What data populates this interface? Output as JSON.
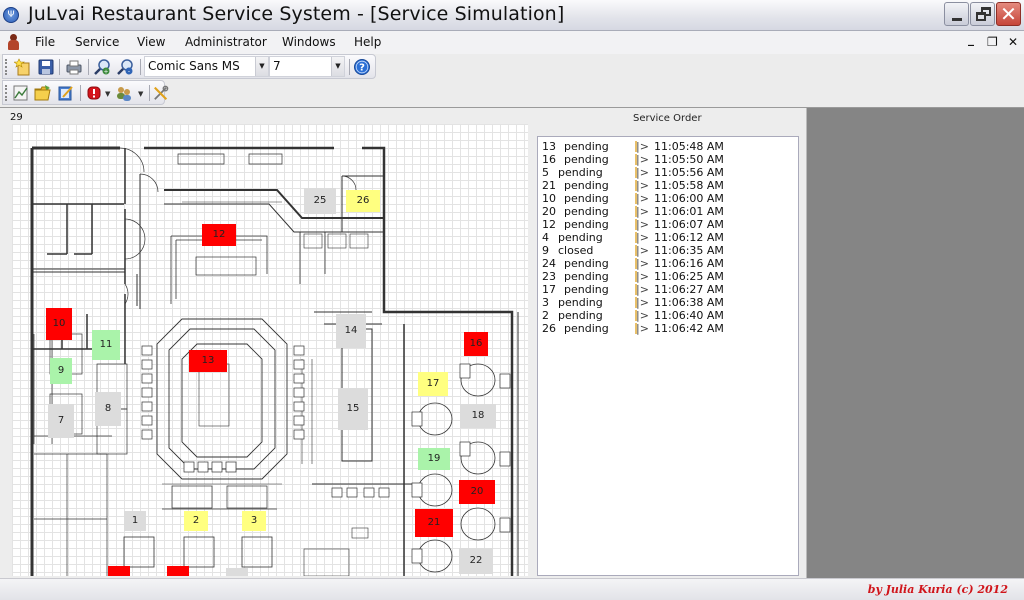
{
  "window": {
    "title": "JuLvai Restaurant Service System - [Service Simulation]",
    "controls": {
      "minimize": "_",
      "restore": "❐",
      "close": "✕"
    }
  },
  "menubar": {
    "items": [
      "File",
      "Service",
      "View",
      "Administrator",
      "Windows",
      "Help"
    ],
    "mdi_controls": {
      "minimize": "_",
      "restore": "❐",
      "close": "✕"
    }
  },
  "toolbar1": {
    "icons": [
      "new-icon",
      "save-icon",
      "print-icon",
      "zoom-in-icon",
      "zoom-out-icon",
      "help-icon"
    ],
    "font_name": "Comic Sans MS",
    "font_size": "7"
  },
  "toolbar2": {
    "icons": [
      "report-icon",
      "open-folder-icon",
      "edit-icon",
      "alert-icon",
      "users-icon",
      "tools-icon"
    ]
  },
  "simulation": {
    "counter": "29",
    "colors": {
      "pending": "#ff0000",
      "served": "#ffff80",
      "closed": "#aaf3aa",
      "free": "#dcdcdc"
    },
    "tables": [
      {
        "id": "1",
        "status": "free"
      },
      {
        "id": "2",
        "status": "served"
      },
      {
        "id": "3",
        "status": "served"
      },
      {
        "id": "7",
        "status": "free"
      },
      {
        "id": "8",
        "status": "free"
      },
      {
        "id": "9",
        "status": "closed"
      },
      {
        "id": "10",
        "status": "pending"
      },
      {
        "id": "11",
        "status": "closed"
      },
      {
        "id": "12",
        "status": "pending"
      },
      {
        "id": "13",
        "status": "pending"
      },
      {
        "id": "14",
        "status": "free"
      },
      {
        "id": "15",
        "status": "free"
      },
      {
        "id": "16",
        "status": "pending"
      },
      {
        "id": "17",
        "status": "served"
      },
      {
        "id": "18",
        "status": "free"
      },
      {
        "id": "19",
        "status": "closed"
      },
      {
        "id": "20",
        "status": "pending"
      },
      {
        "id": "21",
        "status": "pending"
      },
      {
        "id": "22",
        "status": "free"
      },
      {
        "id": "25",
        "status": "free"
      },
      {
        "id": "26",
        "status": "served"
      }
    ]
  },
  "service_order": {
    "title": "Service Order",
    "separator": "|>",
    "rows": [
      {
        "table": "13",
        "status": "pending",
        "time": "11:05:48 AM"
      },
      {
        "table": "16",
        "status": "pending",
        "time": "11:05:50 AM"
      },
      {
        "table": "5",
        "status": "pending",
        "time": "11:05:56 AM"
      },
      {
        "table": "21",
        "status": "pending",
        "time": "11:05:58 AM"
      },
      {
        "table": "10",
        "status": "pending",
        "time": "11:06:00 AM"
      },
      {
        "table": "20",
        "status": "pending",
        "time": "11:06:01 AM"
      },
      {
        "table": "12",
        "status": "pending",
        "time": "11:06:07 AM"
      },
      {
        "table": "4",
        "status": "pending",
        "time": "11:06:12 AM"
      },
      {
        "table": "9",
        "status": "closed",
        "time": "11:06:35 AM"
      },
      {
        "table": "24",
        "status": "pending",
        "time": "11:06:16 AM"
      },
      {
        "table": "23",
        "status": "pending",
        "time": "11:06:25 AM"
      },
      {
        "table": "17",
        "status": "pending",
        "time": "11:06:27 AM"
      },
      {
        "table": "3",
        "status": "pending",
        "time": "11:06:38 AM"
      },
      {
        "table": "2",
        "status": "pending",
        "time": "11:06:40 AM"
      },
      {
        "table": "26",
        "status": "pending",
        "time": "11:06:42 AM"
      }
    ]
  },
  "statusbar": {
    "credit": "by Julia Kuria (c) 2012"
  }
}
